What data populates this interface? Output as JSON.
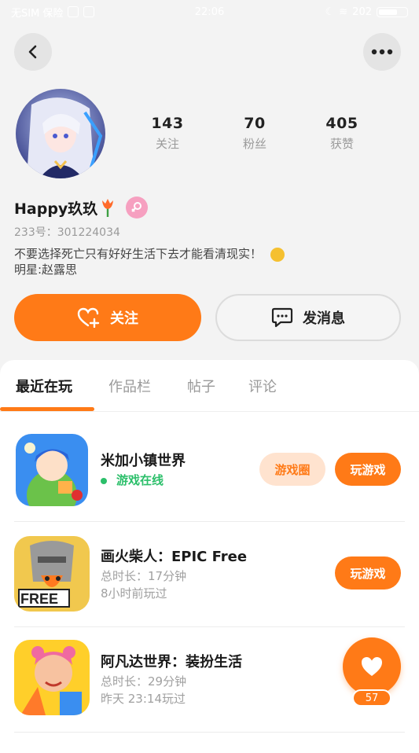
{
  "status_bar": {
    "carrier": "无SIM 保险",
    "time": "22:06",
    "battery_text": "202"
  },
  "profile": {
    "followers_stats": [
      {
        "value": "143",
        "label": "关注"
      },
      {
        "value": "70",
        "label": "粉丝"
      },
      {
        "value": "405",
        "label": "获赞"
      }
    ],
    "nickname": "Happy玖玖",
    "uid": "233号：301224034",
    "bio_line1": "不要选择死亡只有好好生活下去才能看清现实！",
    "bio_line2": "明星:赵露思"
  },
  "actions": {
    "follow_label": "关注",
    "message_label": "发消息"
  },
  "tabs": [
    {
      "label": "最近在玩",
      "active": true
    },
    {
      "label": "作品栏",
      "active": false
    },
    {
      "label": "帖子",
      "active": false
    },
    {
      "label": "评论",
      "active": false
    }
  ],
  "games": [
    {
      "name": "米加小镇世界",
      "status": "游戏在线",
      "circle_button": "游戏圈",
      "play_button": "玩游戏"
    },
    {
      "name": "画火柴人：EPIC Free",
      "duration": "总时长：17分钟",
      "last_played": "8小时前玩过",
      "play_button": "玩游戏",
      "icon_text": "FREE"
    },
    {
      "name": "阿凡达世界：装扮生活",
      "duration": "总时长：29分钟",
      "last_played": "昨天 23:14玩过"
    }
  ],
  "floating_like": {
    "count": "57"
  },
  "colors": {
    "accent": "#ff7a17",
    "online": "#2bbf6a",
    "background": "#f3f3f3"
  }
}
